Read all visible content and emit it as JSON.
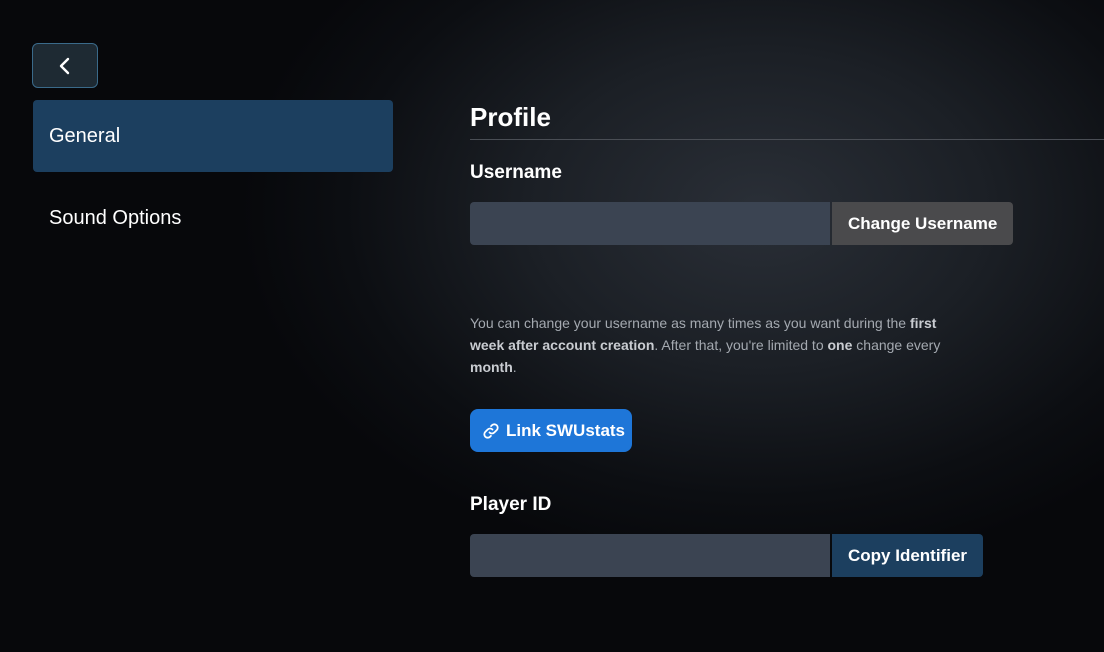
{
  "nav": {
    "back_icon": "chevron-left-icon"
  },
  "sidebar": {
    "items": [
      {
        "label": "General",
        "active": true
      },
      {
        "label": "Sound Options",
        "active": false
      }
    ]
  },
  "profile": {
    "title": "Profile",
    "username": {
      "label": "Username",
      "value": "",
      "button_label": "Change Username"
    },
    "help": {
      "part1": "You can change your username as many times as you want during the ",
      "bold1": "first week after account creation",
      "part2": ". After that, you're limited to ",
      "bold2": "one",
      "part3": " change every ",
      "bold3": "month",
      "part4": "."
    },
    "link_button": {
      "label": "Link SWUstats",
      "icon": "link-icon"
    },
    "player_id": {
      "label": "Player ID",
      "value": "",
      "button_label": "Copy Identifier"
    }
  },
  "colors": {
    "active_nav": "#1c3f5f",
    "link_button": "#1e76d8",
    "input_bg": "#3b4452",
    "grey_button": "#4a4a4c"
  }
}
